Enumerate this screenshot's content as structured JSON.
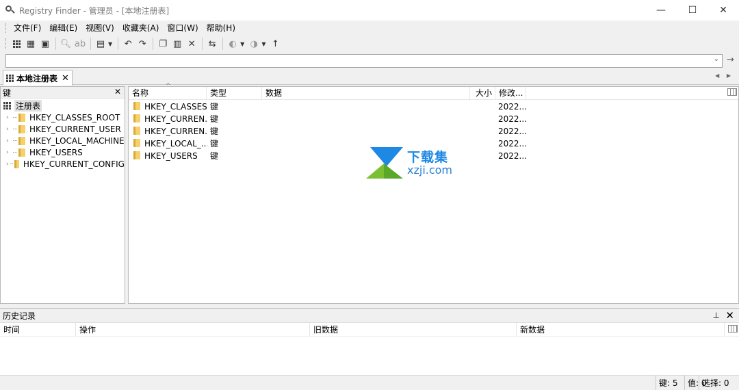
{
  "window": {
    "title": "Registry Finder - 管理员 - [本地注册表]",
    "minimize_glyph": "—",
    "maximize_glyph": "☐",
    "close_glyph": "✕"
  },
  "menu": {
    "items": [
      "文件(F)",
      "编辑(E)",
      "视图(V)",
      "收藏夹(A)",
      "窗口(W)",
      "帮助(H)"
    ]
  },
  "toolbar": {
    "icons": [
      "grid-icon",
      "grid-globe-icon",
      "grid-save-icon",
      "find-icon",
      "replace-icon",
      "export-icon",
      "undo-icon",
      "redo-icon",
      "copy-icon",
      "paste-icon",
      "delete-icon",
      "refresh-icon",
      "back-icon",
      "forward-icon",
      "up-icon"
    ]
  },
  "address": {
    "value": "",
    "go_glyph": "→"
  },
  "tabs": {
    "doc_tab_label": "本地注册表",
    "close_glyph": "✕",
    "nav_glyphs": "◀ ▶"
  },
  "tree": {
    "header": "键",
    "close_glyph": "✕",
    "root": "注册表",
    "items": [
      "HKEY_CLASSES_ROOT",
      "HKEY_CURRENT_USER",
      "HKEY_LOCAL_MACHINE",
      "HKEY_USERS",
      "HKEY_CURRENT_CONFIG"
    ]
  },
  "list": {
    "columns": {
      "name": "名称",
      "type": "类型",
      "data": "数据",
      "size": "大小",
      "modified": "修改..."
    },
    "sort_glyph": "^",
    "rows": [
      {
        "name": "HKEY_CLASSES...",
        "type": "键",
        "data": "",
        "size": "",
        "modified": "2022..."
      },
      {
        "name": "HKEY_CURREN...",
        "type": "键",
        "data": "",
        "size": "",
        "modified": "2022..."
      },
      {
        "name": "HKEY_CURREN...",
        "type": "键",
        "data": "",
        "size": "",
        "modified": "2022..."
      },
      {
        "name": "HKEY_LOCAL_...",
        "type": "键",
        "data": "",
        "size": "",
        "modified": "2022..."
      },
      {
        "name": "HKEY_USERS",
        "type": "键",
        "data": "",
        "size": "",
        "modified": "2022..."
      }
    ]
  },
  "watermark": {
    "title": "下载集",
    "subtitle": "xzji.com"
  },
  "history": {
    "title": "历史记录",
    "pin_glyph": "⊥",
    "close_glyph": "✕",
    "columns": {
      "time": "时间",
      "action": "操作",
      "old": "旧数据",
      "new": "新数据"
    }
  },
  "status": {
    "keys": "键: 5",
    "values": "值: 0",
    "selection": "选择: 0"
  },
  "colors": {
    "folder": "#f6d06a",
    "watermark_blue": "#1e88e5",
    "watermark_green": "#7cbf33"
  }
}
